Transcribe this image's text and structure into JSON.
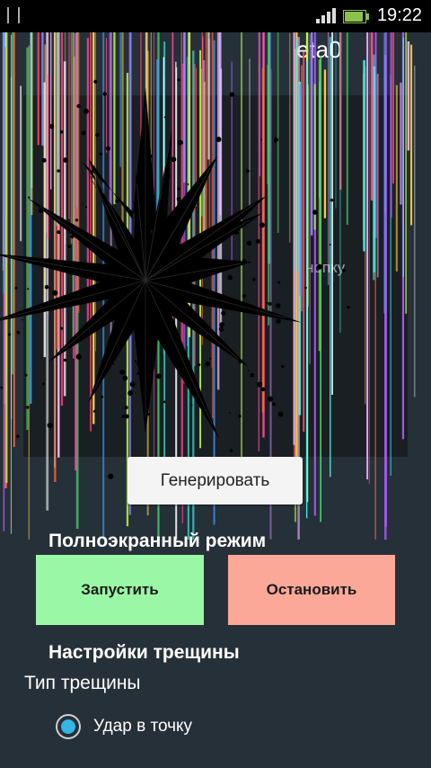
{
  "status_bar": {
    "time": "19:22",
    "battery_level": 0.9
  },
  "app": {
    "title_visible": "eta0"
  },
  "preview": {
    "hint_text": "нопку"
  },
  "generate": {
    "label": "Генерировать"
  },
  "fullscreen": {
    "title": "Полноэкранный режим",
    "start_label": "Запустить",
    "stop_label": "Остановить"
  },
  "crack_settings": {
    "title": "Настройки трещины",
    "type_label": "Тип трещины",
    "options": [
      {
        "label": "Удар в точку",
        "selected": true
      }
    ]
  },
  "colors": {
    "background": "#263038",
    "start": "#9af7a6",
    "stop": "#fca898",
    "radio_accent": "#33b5e5"
  },
  "icons": [
    "notification-icon",
    "signal-icon",
    "battery-icon",
    "crack-image"
  ]
}
